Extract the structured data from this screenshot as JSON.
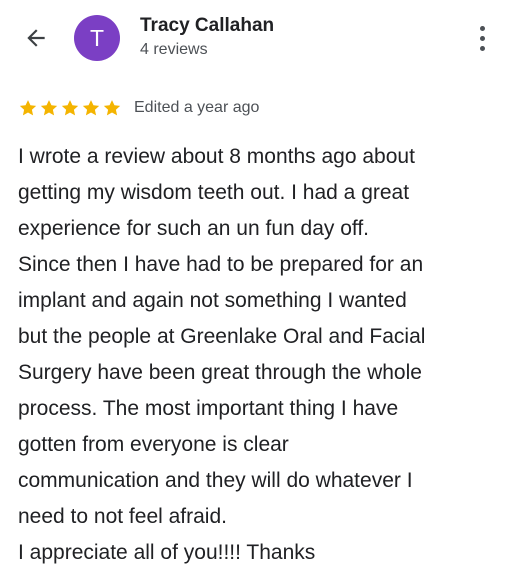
{
  "header": {
    "back_icon": "arrow-left-icon",
    "avatar_letter": "T",
    "avatar_color": "#7b3fc4",
    "reviewer_name": "Tracy Callahan",
    "reviewer_meta": "4 reviews",
    "more_icon": "more-vertical-icon"
  },
  "review": {
    "rating": 5,
    "rating_max": 5,
    "star_color": "#f4b400",
    "edited_label": "Edited a year ago",
    "lines": [
      "I wrote a review about 8 months ago about",
      "getting my wisdom teeth out. I had a great",
      "experience for such an un fun day off.",
      "Since then I have had to be prepared for an",
      "implant and again not something I wanted",
      "but the people at Greenlake Oral and Facial",
      "Surgery have been great through the whole",
      "process. The most important thing I have",
      "gotten from everyone is clear",
      "communication and they will do whatever I",
      "need to not feel afraid.",
      "I appreciate all of you!!!! Thanks"
    ]
  }
}
